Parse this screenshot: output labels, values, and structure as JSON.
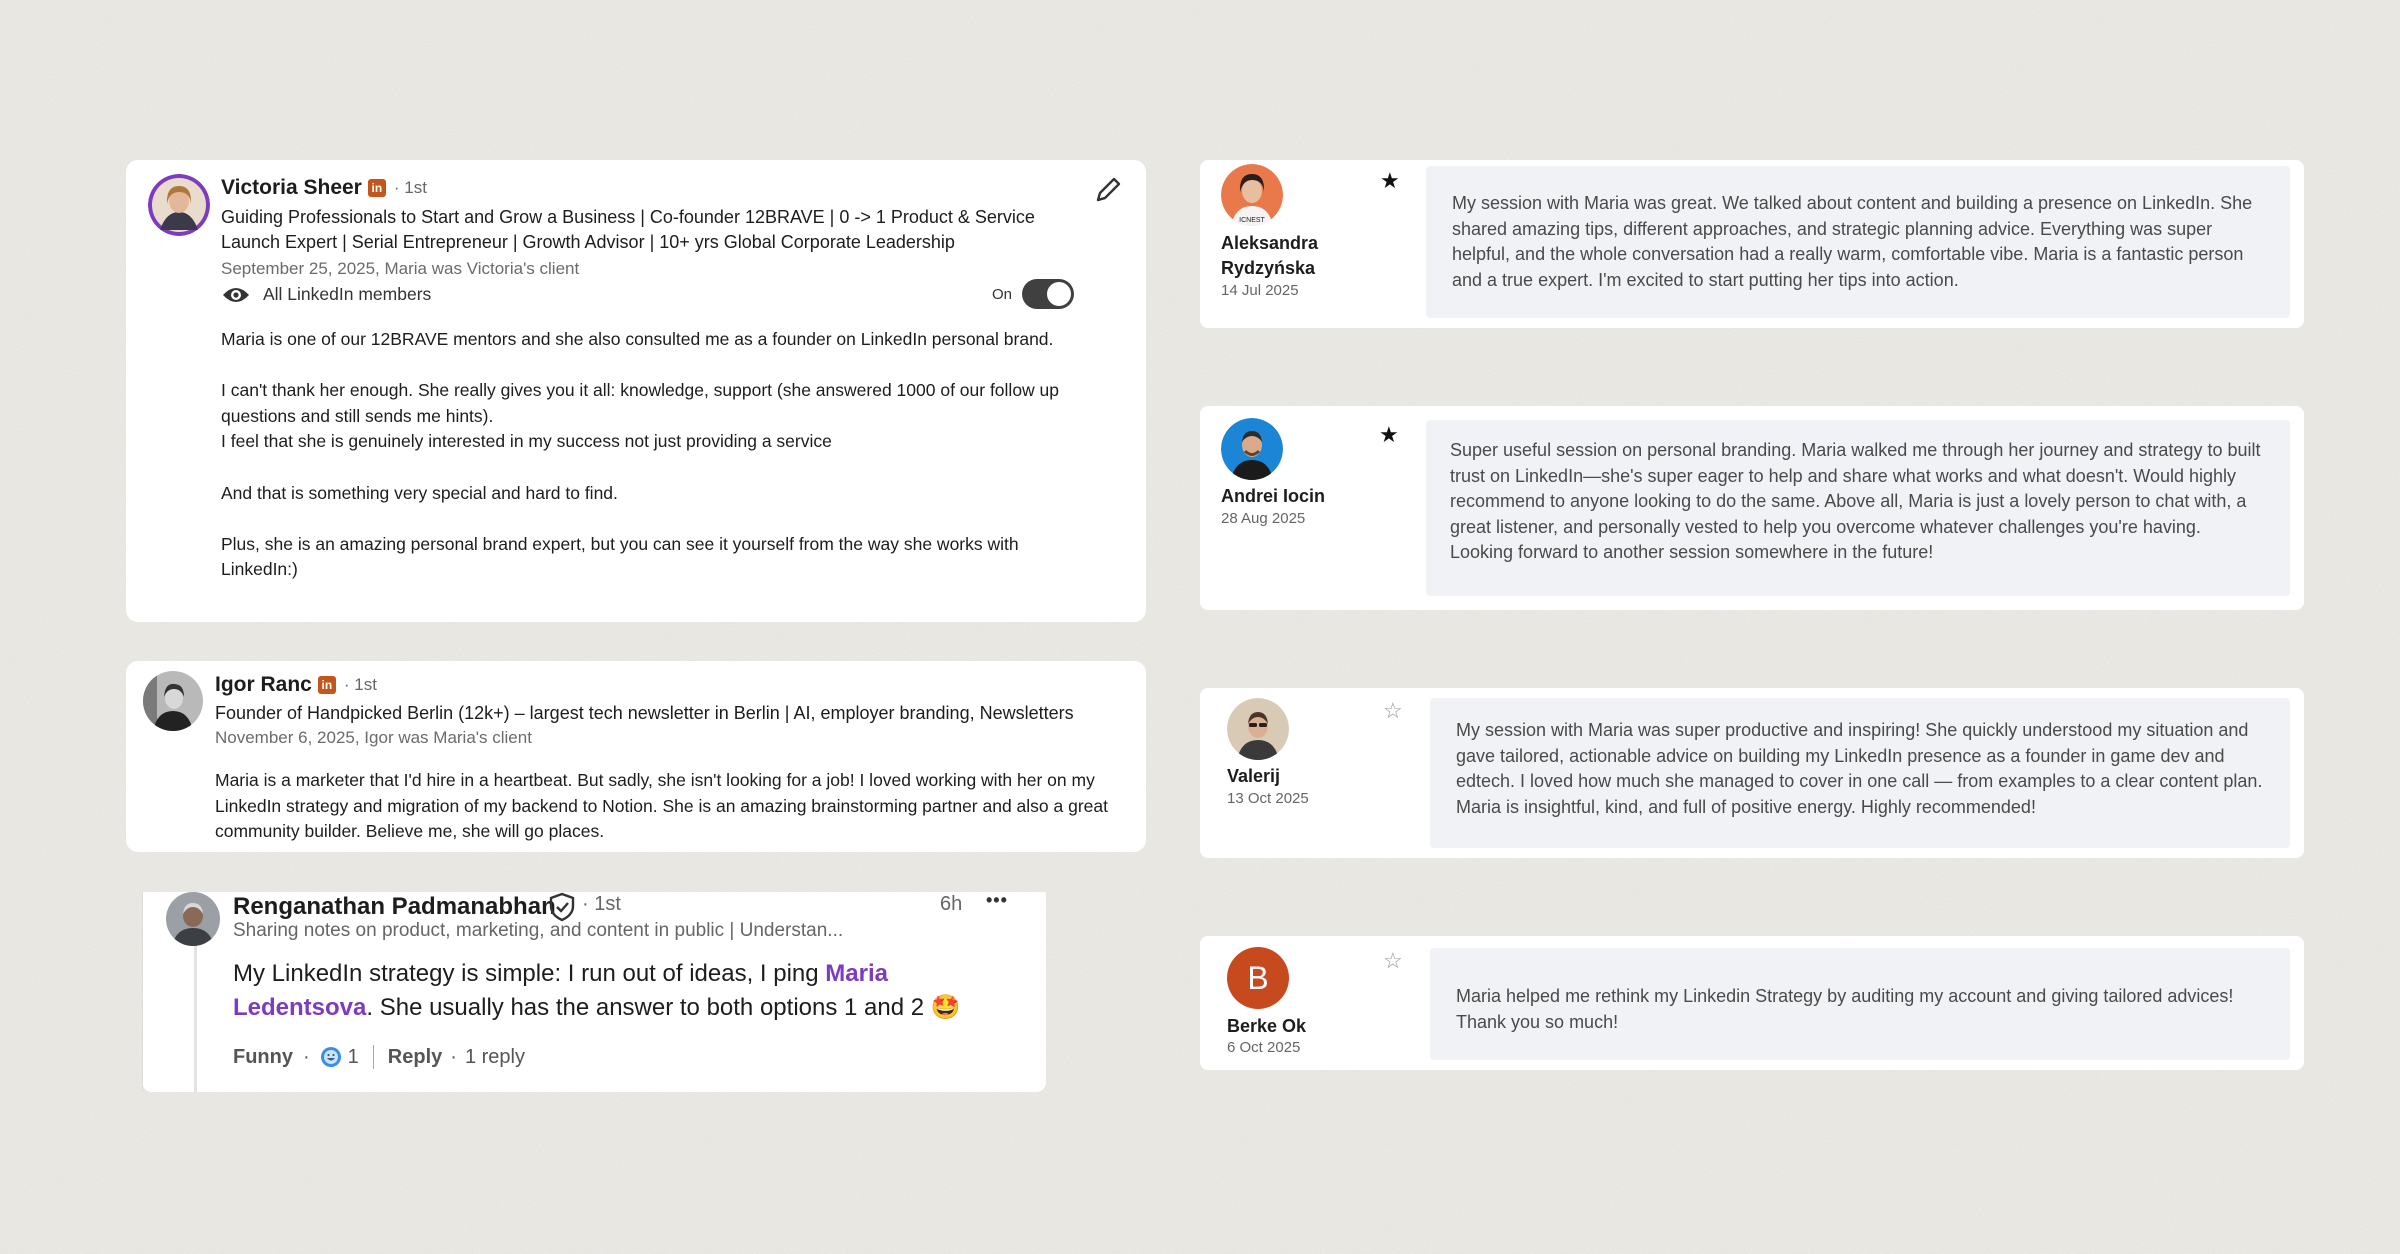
{
  "recommendations": [
    {
      "name": "Victoria Sheer",
      "badge": "in",
      "degree": "· 1st",
      "headline": "Guiding Professionals to Start and Grow a Business | Co-founder 12BRAVE | 0 -> 1 Product & Service Launch Expert | Serial Entrepreneur | Growth Advisor | 10+ yrs Global Corporate Leadership",
      "meta": "September 25, 2025, Maria was Victoria's client",
      "visibility": "All LinkedIn members",
      "toggle_label": "On",
      "paragraphs": [
        "Maria is one of our 12BRAVE mentors and she also consulted me as a founder on LinkedIn personal brand.",
        "I can't thank her enough. She really gives you it all: knowledge, support (she answered 1000 of our follow up questions and still sends me hints).",
        "I feel that she is genuinely interested in my success not just providing a service",
        "And that is something very special and hard to find.",
        "Plus, she is an amazing personal brand expert, but you can see it yourself from the way she works with LinkedIn:)"
      ]
    },
    {
      "name": "Igor Ranc",
      "badge": "in",
      "degree": "· 1st",
      "headline": "Founder of Handpicked Berlin (12k+) – largest tech newsletter in Berlin | AI, employer branding, Newsletters",
      "meta": "November 6, 2025, Igor was Maria's client",
      "paragraphs": [
        "Maria is a marketer that I'd hire in a heartbeat. But sadly, she isn't looking for a job! I loved working with her on my LinkedIn strategy and migration of my backend to Notion. She is an amazing brainstorming partner and also a great community builder. Believe me, she will go places."
      ]
    }
  ],
  "comment": {
    "name": "Renganathan Padmanabhan",
    "degree": "· 1st",
    "time": "6h",
    "headline": "Sharing notes on product, marketing, and content in public | Understan...",
    "text_before": "My LinkedIn strategy is simple: I run out of ideas, I ping ",
    "mention": "Maria Ledentsova",
    "text_after": ". She usually has the answer to both options 1 and 2 🤩",
    "reaction_label": "Funny",
    "reaction_count": "1",
    "reply_label": "Reply",
    "replies": "1 reply"
  },
  "testimonials": [
    {
      "name": "Aleksandra Rydzyńska",
      "date": "14 Jul 2025",
      "starred": true,
      "text": "My session with Maria was great. We talked about content and building a presence on LinkedIn. She shared amazing tips, different approaches, and strategic planning advice. Everything was super helpful, and the whole conversation had a really warm, comfortable vibe. Maria is a fantastic person and a true expert. I'm excited to start putting her tips into action."
    },
    {
      "name": "Andrei Iocin",
      "date": "28 Aug 2025",
      "starred": true,
      "text": "Super useful session on personal branding. Maria walked me through her journey and strategy to built trust on LinkedIn—she's super eager to help and share what works and what doesn't. Would highly recommend to anyone looking to do the same. Above all, Maria is just a lovely person to chat with, a great listener, and personally vested to help you overcome whatever challenges you're having. Looking forward to another session somewhere in the future!"
    },
    {
      "name": "Valerij",
      "date": "13 Oct 2025",
      "starred": false,
      "text": "My session with Maria was super productive and inspiring! She quickly understood my situation and gave tailored, actionable advice on building my LinkedIn presence as a founder in game dev and edtech. I loved how much she managed to cover in one call — from examples to a clear content plan. Maria is insightful, kind, and full of positive energy. Highly recommended!"
    },
    {
      "name": "Berke Ok",
      "date": "6 Oct 2025",
      "starred": false,
      "avatar_letter": "B",
      "text": "Maria helped me rethink my Linkedin Strategy by auditing my account and giving tailored advices! Thank you so much!"
    }
  ],
  "icons": {
    "star_filled": "★",
    "star_empty": "☆",
    "more": "•••",
    "edit": "pencil-icon",
    "visibility": "eye-icon"
  },
  "colors": {
    "background": "#efeee9",
    "card": "#ffffff",
    "testimonial_box": "#f1f2f6",
    "mention": "#7d3bbf",
    "linkedin_badge": "#c2571c",
    "berke_avatar": "#c64a1d"
  }
}
